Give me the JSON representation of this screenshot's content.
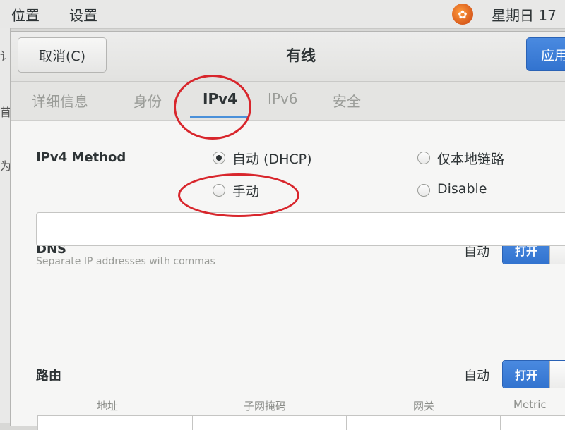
{
  "topbar": {
    "menu": [
      "位置",
      "设置"
    ],
    "tray_icon": "ubuntu-logo-icon",
    "clock": "星期日 17"
  },
  "background_window": {
    "fragments": [
      "讠",
      "苜",
      "为"
    ]
  },
  "dialog": {
    "cancel_label": "取消(C)",
    "title": "有线",
    "apply_label": "应用"
  },
  "tabs": [
    {
      "label": "详细信息",
      "active": false
    },
    {
      "label": "身份",
      "active": false
    },
    {
      "label": "IPv4",
      "active": true
    },
    {
      "label": "IPv6",
      "active": false
    },
    {
      "label": "安全",
      "active": false
    }
  ],
  "ipv4": {
    "method_label": "IPv4 Method",
    "options": [
      {
        "label": "自动 (DHCP)",
        "checked": true
      },
      {
        "label": "仅本地链路",
        "checked": false
      },
      {
        "label": "手动",
        "checked": false
      },
      {
        "label": "Disable",
        "checked": false
      }
    ]
  },
  "dns": {
    "label": "DNS",
    "auto_label": "自动",
    "switch_label": "打开",
    "switch_on": true,
    "input_value": "",
    "hint": "Separate IP addresses with commas"
  },
  "routes": {
    "label": "路由",
    "auto_label": "自动",
    "switch_label": "打开",
    "switch_on": true,
    "columns": [
      "地址",
      "子网掩码",
      "网关",
      "Metric"
    ]
  },
  "annotation_color": "#d8262c"
}
